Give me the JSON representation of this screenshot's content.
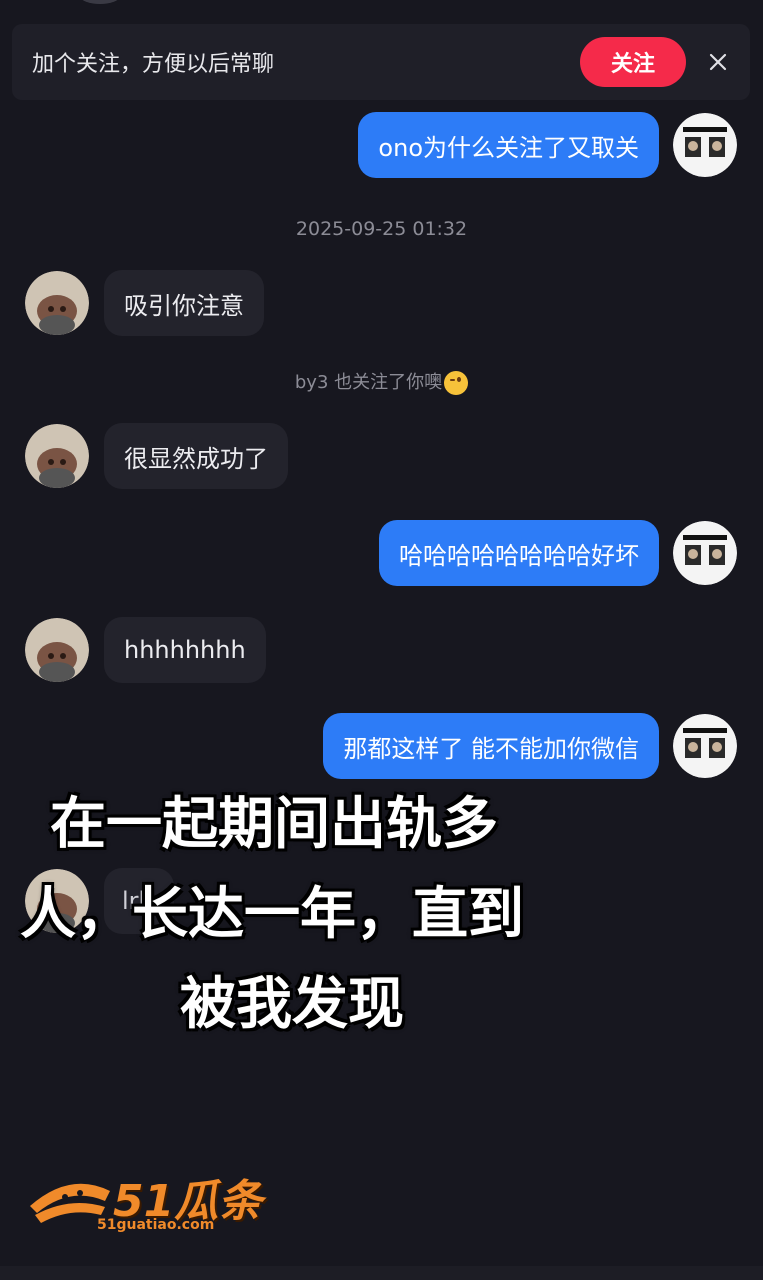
{
  "follow_bar": {
    "prompt": "加个关注，方便以后常聊",
    "follow_label": "关注",
    "close_icon": "close-icon"
  },
  "timestamp": "2025-09-25 01:32",
  "system_note": {
    "text": "by3 也关注了你噢",
    "emoji": "wink-emoji"
  },
  "messages": [
    {
      "side": "me",
      "text": "ono为什么关注了又取关"
    },
    {
      "side": "them",
      "text": "吸引你注意"
    },
    {
      "side": "them",
      "text": "很显然成功了"
    },
    {
      "side": "me",
      "text": "哈哈哈哈哈哈哈哈好坏"
    },
    {
      "side": "them",
      "text": "hhhhhhhh"
    },
    {
      "side": "me",
      "text": "那都这样了 能不能加你微信"
    },
    {
      "side": "them",
      "text": "lrb"
    }
  ],
  "overlay_caption": {
    "line1": "在一起期间出轨多",
    "line2": "人，长达一年，直到",
    "line3": "被我发现"
  },
  "watermark": {
    "brand": "51瓜条",
    "url": "51guatiao.com"
  },
  "colors": {
    "background": "#17171f",
    "my_bubble": "#2d7cf7",
    "their_bubble": "#23232c",
    "follow_button": "#f52a4a",
    "watermark": "#f08a2a"
  }
}
